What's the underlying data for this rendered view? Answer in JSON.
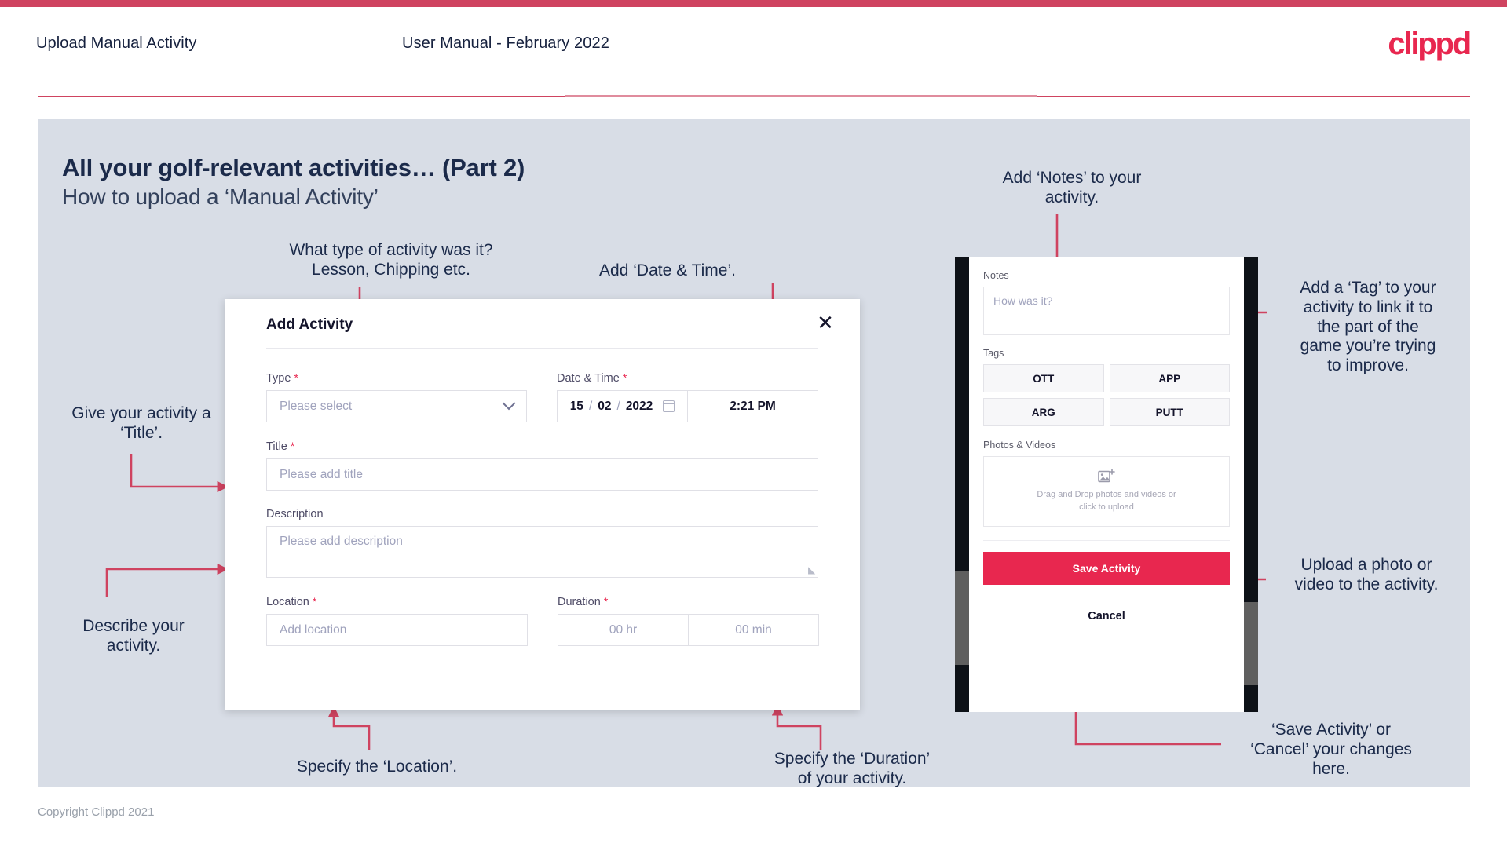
{
  "header": {
    "title": "Upload Manual Activity",
    "subtitle": "User Manual - February 2022",
    "brand": "clippd"
  },
  "slide": {
    "title": "All your golf-relevant activities… (Part 2)",
    "subtitle": "How to upload a ‘Manual Activity’"
  },
  "footer": {
    "copyright": "Copyright Clippd 2021"
  },
  "colors": {
    "accent": "#e8274f",
    "accent_bar": "#cf4360",
    "canvas": "#d8dde6",
    "ink": "#1b2a4a",
    "placeholder": "#a0a3bd"
  },
  "dialog": {
    "title": "Add Activity",
    "close_icon": "close-icon",
    "fields": {
      "type": {
        "label": "Type",
        "required": "*",
        "placeholder": "Please select"
      },
      "datetime": {
        "label": "Date & Time",
        "required": "*",
        "day": "15",
        "month": "02",
        "year": "2022",
        "sep": "/",
        "time": "2:21 PM"
      },
      "title": {
        "label": "Title",
        "required": "*",
        "placeholder": "Please add title"
      },
      "description": {
        "label": "Description",
        "placeholder": "Please add description"
      },
      "location": {
        "label": "Location",
        "required": "*",
        "placeholder": "Add location"
      },
      "duration": {
        "label": "Duration",
        "required": "*",
        "hours": "00 hr",
        "minutes": "00 min"
      }
    }
  },
  "phone": {
    "notes": {
      "label": "Notes",
      "placeholder": "How was it?"
    },
    "tags": {
      "label": "Tags",
      "items": [
        "OTT",
        "APP",
        "ARG",
        "PUTT"
      ]
    },
    "photos": {
      "label": "Photos & Videos",
      "dropzone_line1": "Drag and Drop photos and videos or",
      "dropzone_line2": "click to upload",
      "icon": "add-image-icon"
    },
    "save_label": "Save Activity",
    "cancel_label": "Cancel"
  },
  "annotations": {
    "type": "What type of activity was it?\nLesson, Chipping etc.",
    "datetime": "Add ‘Date & Time’.",
    "title": "Give your activity a\n‘Title’.",
    "description": "Describe your\nactivity.",
    "location": "Specify the ‘Location’.",
    "duration": "Specify the ‘Duration’\nof your activity.",
    "notes": "Add ‘Notes’ to your\nactivity.",
    "tags": "Add a ‘Tag’ to your\nactivity to link it to\nthe part of the\ngame you’re trying\nto improve.",
    "upload": "Upload a photo or\nvideo to the activity.",
    "save": "‘Save Activity’ or\n‘Cancel’ your changes\nhere."
  }
}
